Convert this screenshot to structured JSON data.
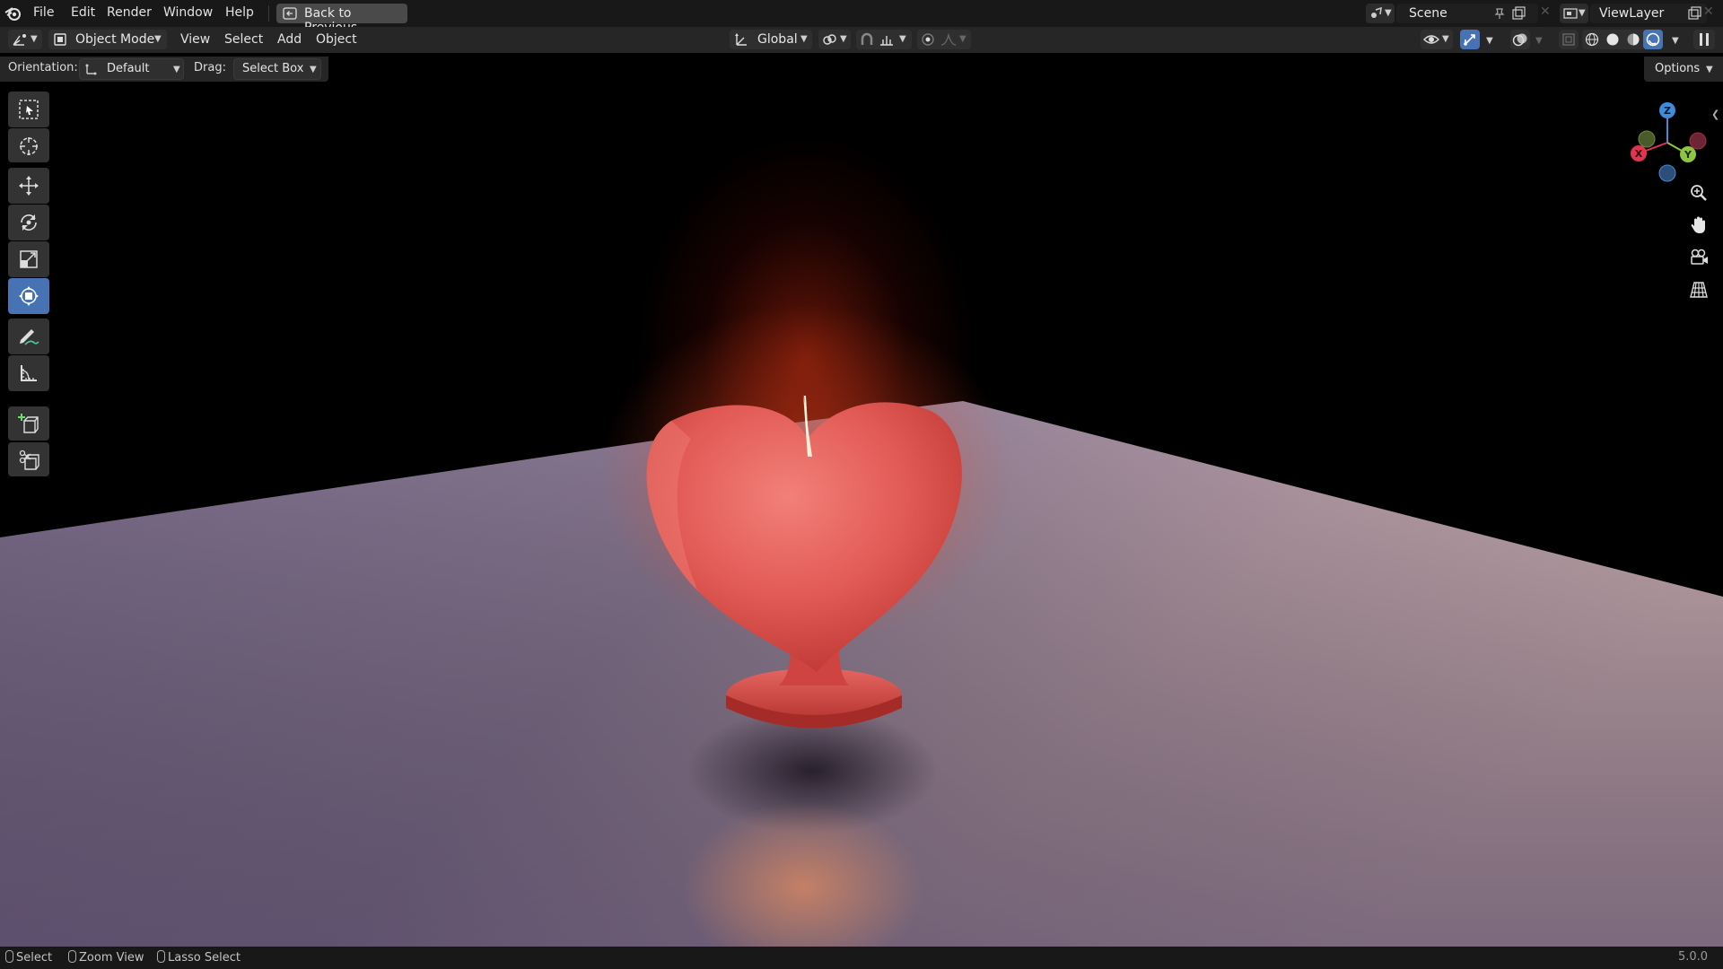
{
  "menu": {
    "file": "File",
    "edit": "Edit",
    "render": "Render",
    "window": "Window",
    "help": "Help",
    "back_button": "Back to Previous"
  },
  "scene": {
    "label": "Scene"
  },
  "view_layer": {
    "label": "ViewLayer"
  },
  "header": {
    "mode": "Object Mode",
    "view": "View",
    "select": "Select",
    "add": "Add",
    "object": "Object",
    "transform_orientation": "Global"
  },
  "tool_settings": {
    "orientation_label": "Orientation:",
    "orientation_value": "Default",
    "drag_label": "Drag:",
    "drag_value": "Select Box",
    "options": "Options"
  },
  "gizmo": {
    "z": "Z",
    "x": "X",
    "y": "Y"
  },
  "status": {
    "select": "Select",
    "zoom": "Zoom View",
    "lasso": "Lasso Select",
    "version": "5.0.0"
  },
  "colors": {
    "accent": "#4772b3",
    "x_axis": "#e2334f",
    "y_axis": "#8ec63f",
    "z_axis": "#3f8bdc"
  },
  "icons": [
    "blender-logo-icon",
    "back-icon",
    "editor-type-icon",
    "object-mode-icon",
    "orientation-icon",
    "pivot-icon",
    "snap-icon",
    "proportional-icon",
    "visibility-icon",
    "gizmo-icon",
    "overlay-icon",
    "xray-icon",
    "wireframe-shading-icon",
    "solid-shading-icon",
    "material-shading-icon",
    "rendered-shading-icon",
    "select-box-icon",
    "cursor-icon",
    "move-icon",
    "rotate-icon",
    "scale-icon",
    "transform-icon",
    "annotate-icon",
    "measure-icon",
    "add-cube-icon",
    "add-object-icon",
    "zoom-icon",
    "hand-icon",
    "camera-icon",
    "grid-icon"
  ]
}
